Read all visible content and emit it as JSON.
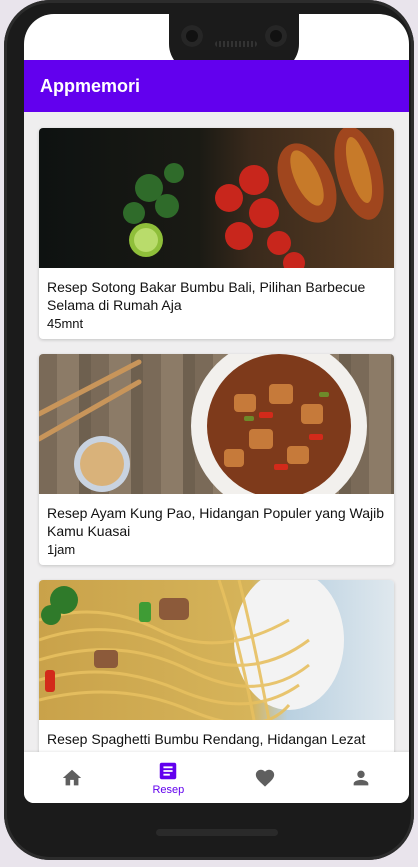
{
  "app": {
    "title": "Appmemori"
  },
  "recipes": [
    {
      "title": "Resep Sotong Bakar Bumbu Bali, Pilihan Barbecue Selama di Rumah Aja",
      "time": "45mnt"
    },
    {
      "title": "Resep Ayam Kung Pao, Hidangan Populer yang Wajib Kamu Kuasai",
      "time": "1jam"
    },
    {
      "title": "Resep Spaghetti Bumbu Rendang, Hidangan Lezat Perpaduan Dua Dunia",
      "time": ""
    }
  ],
  "bottom_nav": {
    "items": [
      {
        "icon": "home-icon",
        "label": ""
      },
      {
        "icon": "recipe-icon",
        "label": "Resep"
      },
      {
        "icon": "heart-icon",
        "label": ""
      },
      {
        "icon": "person-icon",
        "label": ""
      }
    ],
    "active_index": 1
  },
  "colors": {
    "primary": "#6200ee",
    "background": "#efeeef"
  }
}
